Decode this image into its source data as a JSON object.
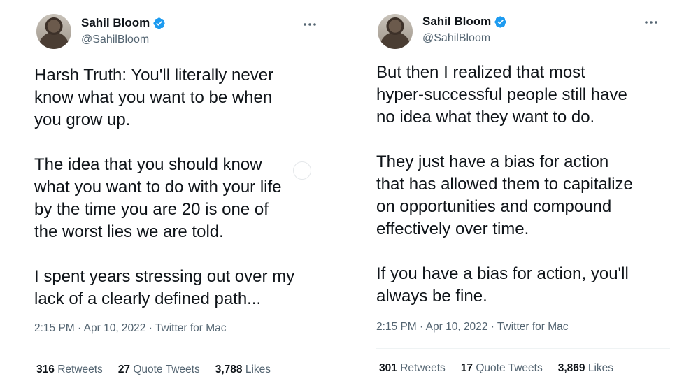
{
  "tweets": [
    {
      "name": "Sahil Bloom",
      "handle": "@SahilBloom",
      "text": "Harsh Truth: You'll literally never\nknow what you want to be when\nyou grow up.\n\nThe idea that you should know\nwhat you want to do with your life\nby the time you are 20 is one of\nthe worst lies we are told.\n\nI spent years stressing out over my\nlack of a clearly defined path...",
      "time": "2:15 PM",
      "date": "Apr 10, 2022",
      "source": "Twitter for Mac",
      "retweets": "316",
      "retweets_label": "Retweets",
      "quotes": "27",
      "quotes_label": "Quote Tweets",
      "likes": "3,788",
      "likes_label": "Likes"
    },
    {
      "name": "Sahil Bloom",
      "handle": "@SahilBloom",
      "text": "But then I realized that most\nhyper-successful people still have\nno idea what they want to do.\n\nThey just have a bias for action\nthat has allowed them to capitalize\non opportunities and compound\neffectively over time.\n\nIf you have a bias for action, you'll\nalways be fine.",
      "time": "2:15 PM",
      "date": "Apr 10, 2022",
      "source": "Twitter for Mac",
      "retweets": "301",
      "retweets_label": "Retweets",
      "quotes": "17",
      "quotes_label": "Quote Tweets",
      "likes": "3,869",
      "likes_label": "Likes"
    }
  ],
  "meta_separator": " · ",
  "colors": {
    "verified": "#1d9bf0",
    "secondary_text": "#536471",
    "primary_text": "#0f1419"
  },
  "icons": {
    "verified": "verified-badge-icon",
    "more": "more-options-icon"
  }
}
